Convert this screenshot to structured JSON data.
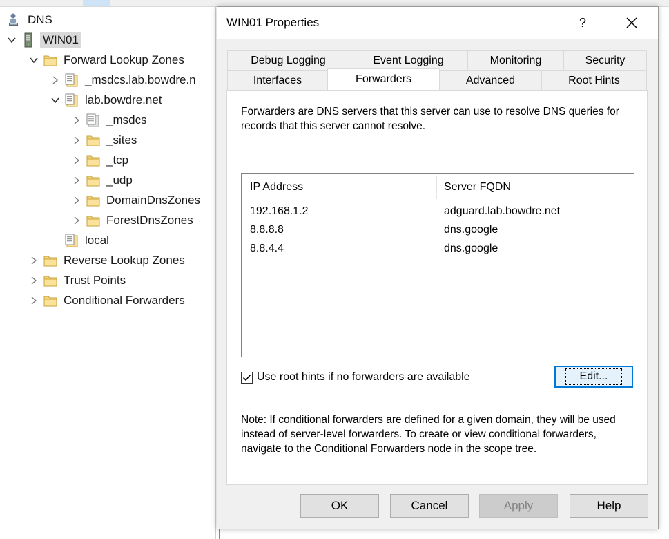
{
  "tree": {
    "items": [
      {
        "label": "DNS",
        "icon": "dns-manager-icon",
        "expand": "none"
      },
      {
        "label": "WIN01",
        "icon": "server-icon",
        "expand": "expanded"
      },
      {
        "label": "Forward Lookup Zones",
        "icon": "folder-icon",
        "expand": "expanded"
      },
      {
        "label": "_msdcs.lab.bowdre.n",
        "icon": "zone-icon",
        "expand": "collapsed"
      },
      {
        "label": "lab.bowdre.net",
        "icon": "zone-icon",
        "expand": "expanded"
      },
      {
        "label": "_msdcs",
        "icon": "delegated-zone-icon",
        "expand": "collapsed"
      },
      {
        "label": "_sites",
        "icon": "folder-icon",
        "expand": "collapsed"
      },
      {
        "label": "_tcp",
        "icon": "folder-icon",
        "expand": "collapsed"
      },
      {
        "label": "_udp",
        "icon": "folder-icon",
        "expand": "collapsed"
      },
      {
        "label": "DomainDnsZones",
        "icon": "folder-icon",
        "expand": "collapsed"
      },
      {
        "label": "ForestDnsZones",
        "icon": "folder-icon",
        "expand": "collapsed"
      },
      {
        "label": "local",
        "icon": "zone-icon",
        "expand": "none"
      },
      {
        "label": "Reverse Lookup Zones",
        "icon": "folder-icon",
        "expand": "collapsed"
      },
      {
        "label": "Trust Points",
        "icon": "folder-icon",
        "expand": "collapsed"
      },
      {
        "label": "Conditional Forwarders",
        "icon": "folder-icon",
        "expand": "collapsed"
      }
    ]
  },
  "dialog": {
    "title": "WIN01 Properties",
    "help_label": "?",
    "tabs_row1": [
      "Debug Logging",
      "Event Logging",
      "Monitoring",
      "Security"
    ],
    "tabs_row2": [
      "Interfaces",
      "Forwarders",
      "Advanced",
      "Root Hints"
    ],
    "active_tab": "Forwarders",
    "description": "Forwarders are DNS servers that this server can use to resolve DNS queries for records that this server cannot resolve.",
    "table": {
      "columns": [
        "IP Address",
        "Server FQDN"
      ],
      "rows": [
        [
          "192.168.1.2",
          "adguard.lab.bowdre.net"
        ],
        [
          "8.8.8.8",
          "dns.google"
        ],
        [
          "8.8.4.4",
          "dns.google"
        ]
      ]
    },
    "root_hints_label": "Use root hints if no forwarders are available",
    "root_hints_checked": true,
    "edit_label": "Edit...",
    "note": "Note: If conditional forwarders are defined for a given domain, they will be used instead of server-level forwarders.  To create or view conditional forwarders, navigate to the Conditional Forwarders node in the scope tree.",
    "buttons": {
      "ok": "OK",
      "cancel": "Cancel",
      "apply": "Apply",
      "help": "Help"
    },
    "accent_color": "#0078d7"
  }
}
